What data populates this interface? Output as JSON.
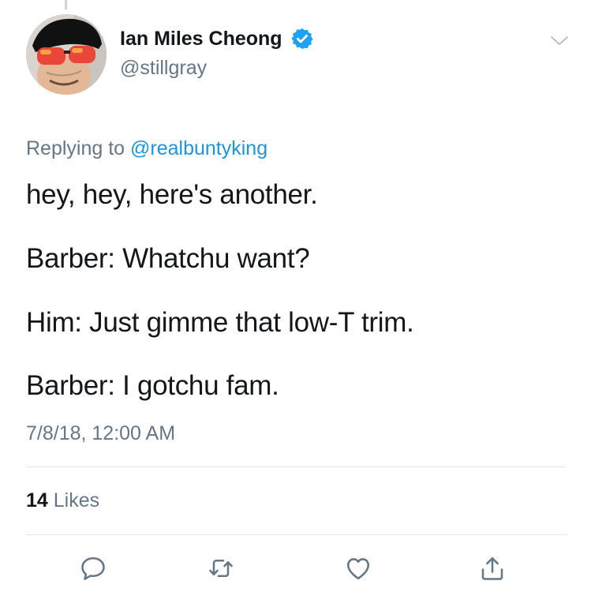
{
  "tweet": {
    "author": {
      "display_name": "Ian Miles Cheong",
      "handle": "@stillgray",
      "verified": true
    },
    "replying_to": {
      "prefix": "Replying to",
      "mention": "@realbuntyking"
    },
    "lines": [
      "hey, hey, here's another.",
      "Barber: Whatchu want?",
      "Him: Just gimme that low-T trim.",
      "Barber: I gotchu fam."
    ],
    "timestamp": "7/8/18, 12:00 AM",
    "likes": {
      "count": "14",
      "label": "Likes"
    },
    "actions": [
      "reply-icon",
      "retweet-icon",
      "like-icon",
      "share-icon"
    ]
  },
  "colors": {
    "link": "#1b95e0",
    "secondary_text": "#657786",
    "primary_text": "#14171a",
    "divider": "#e1e8ed",
    "icon": "#657786"
  }
}
